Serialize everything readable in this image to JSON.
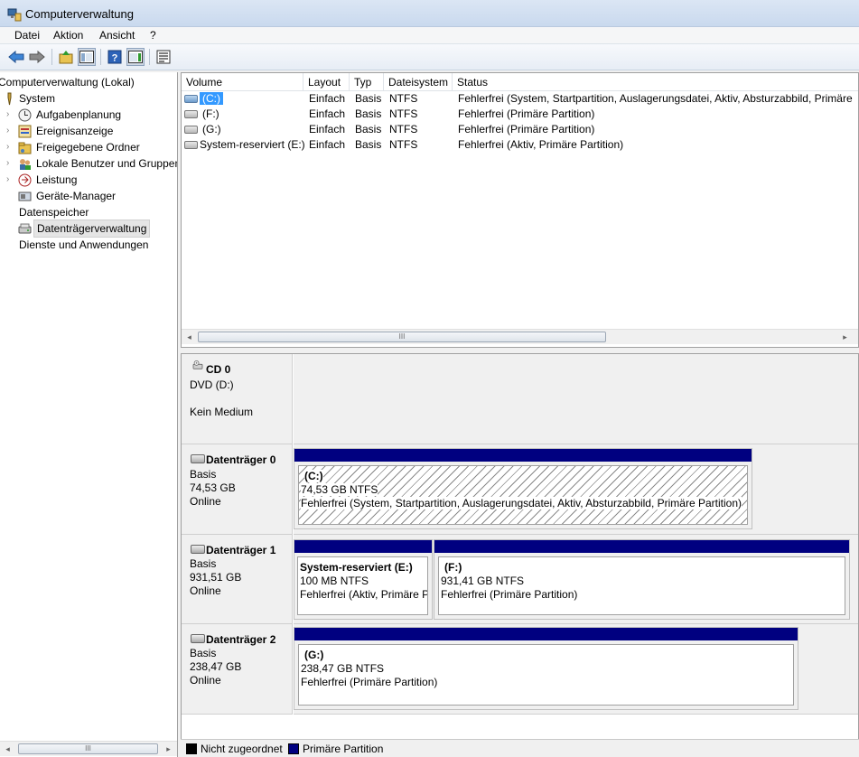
{
  "window": {
    "title": "Computerverwaltung"
  },
  "menu": [
    "Datei",
    "Aktion",
    "Ansicht",
    "?"
  ],
  "toolbar": [
    "back-icon",
    "forward-icon",
    "up-folder-icon",
    "show-hide-tree-icon",
    "help-icon",
    "show-hide-action-pane-icon",
    "properties-icon"
  ],
  "tree": {
    "root": "Computerverwaltung (Lokal)",
    "items": [
      {
        "label": "System",
        "icon": "tools-icon"
      },
      {
        "label": "Aufgabenplanung",
        "icon": "clock-icon"
      },
      {
        "label": "Ereignisanzeige",
        "icon": "event-log-icon"
      },
      {
        "label": "Freigegebene Ordner",
        "icon": "shared-folder-icon"
      },
      {
        "label": "Lokale Benutzer und Gruppen",
        "icon": "users-icon"
      },
      {
        "label": "Leistung",
        "icon": "performance-icon"
      },
      {
        "label": "Geräte-Manager",
        "icon": "device-manager-icon"
      },
      {
        "label": "Datenspeicher",
        "icon": "storage-icon"
      },
      {
        "label": "Datenträgerverwaltung",
        "icon": "disk-management-icon"
      },
      {
        "label": "Dienste und Anwendungen",
        "icon": "services-icon"
      }
    ]
  },
  "volume_table": {
    "columns": [
      "Volume",
      "Layout",
      "Typ",
      "Dateisystem",
      "Status"
    ],
    "rows": [
      {
        "volume": "(C:)",
        "layout": "Einfach",
        "typ": "Basis",
        "fs": "NTFS",
        "status": "Fehlerfrei (System, Startpartition, Auslagerungsdatei, Aktiv, Absturzabbild, Primäre"
      },
      {
        "volume": "(F:)",
        "layout": "Einfach",
        "typ": "Basis",
        "fs": "NTFS",
        "status": "Fehlerfrei (Primäre Partition)"
      },
      {
        "volume": "(G:)",
        "layout": "Einfach",
        "typ": "Basis",
        "fs": "NTFS",
        "status": "Fehlerfrei (Primäre Partition)"
      },
      {
        "volume": "System-reserviert (E:)",
        "layout": "Einfach",
        "typ": "Basis",
        "fs": "NTFS",
        "status": "Fehlerfrei (Aktiv, Primäre Partition)"
      }
    ]
  },
  "disks": [
    {
      "name": "CD 0",
      "lines": [
        "DVD (D:)",
        "",
        "Kein Medium"
      ],
      "partitions": []
    },
    {
      "name": "Datenträger 0",
      "lines": [
        "Basis",
        "74,53 GB",
        "Online"
      ],
      "partitions": [
        {
          "title": "(C:)",
          "size": "74,53 GB NTFS",
          "status": "Fehlerfrei (System, Startpartition, Auslagerungsdatei, Aktiv, Absturzabbild, Primäre Partition)"
        }
      ]
    },
    {
      "name": "Datenträger 1",
      "lines": [
        "Basis",
        "931,51 GB",
        "Online"
      ],
      "partitions": [
        {
          "title": "System-reserviert  (E:)",
          "size": "100 MB NTFS",
          "status": "Fehlerfrei (Aktiv, Primäre P"
        },
        {
          "title": "(F:)",
          "size": "931,41 GB NTFS",
          "status": "Fehlerfrei (Primäre Partition)"
        }
      ]
    },
    {
      "name": "Datenträger 2",
      "lines": [
        "Basis",
        "238,47 GB",
        "Online"
      ],
      "partitions": [
        {
          "title": "(G:)",
          "size": "238,47 GB NTFS",
          "status": "Fehlerfrei (Primäre Partition)"
        }
      ]
    }
  ],
  "legend": [
    {
      "label": "Nicht zugeordnet",
      "color": "#000000"
    },
    {
      "label": "Primäre Partition",
      "color": "#000080"
    }
  ],
  "scrollbar": {
    "thumb_grip": "III"
  }
}
